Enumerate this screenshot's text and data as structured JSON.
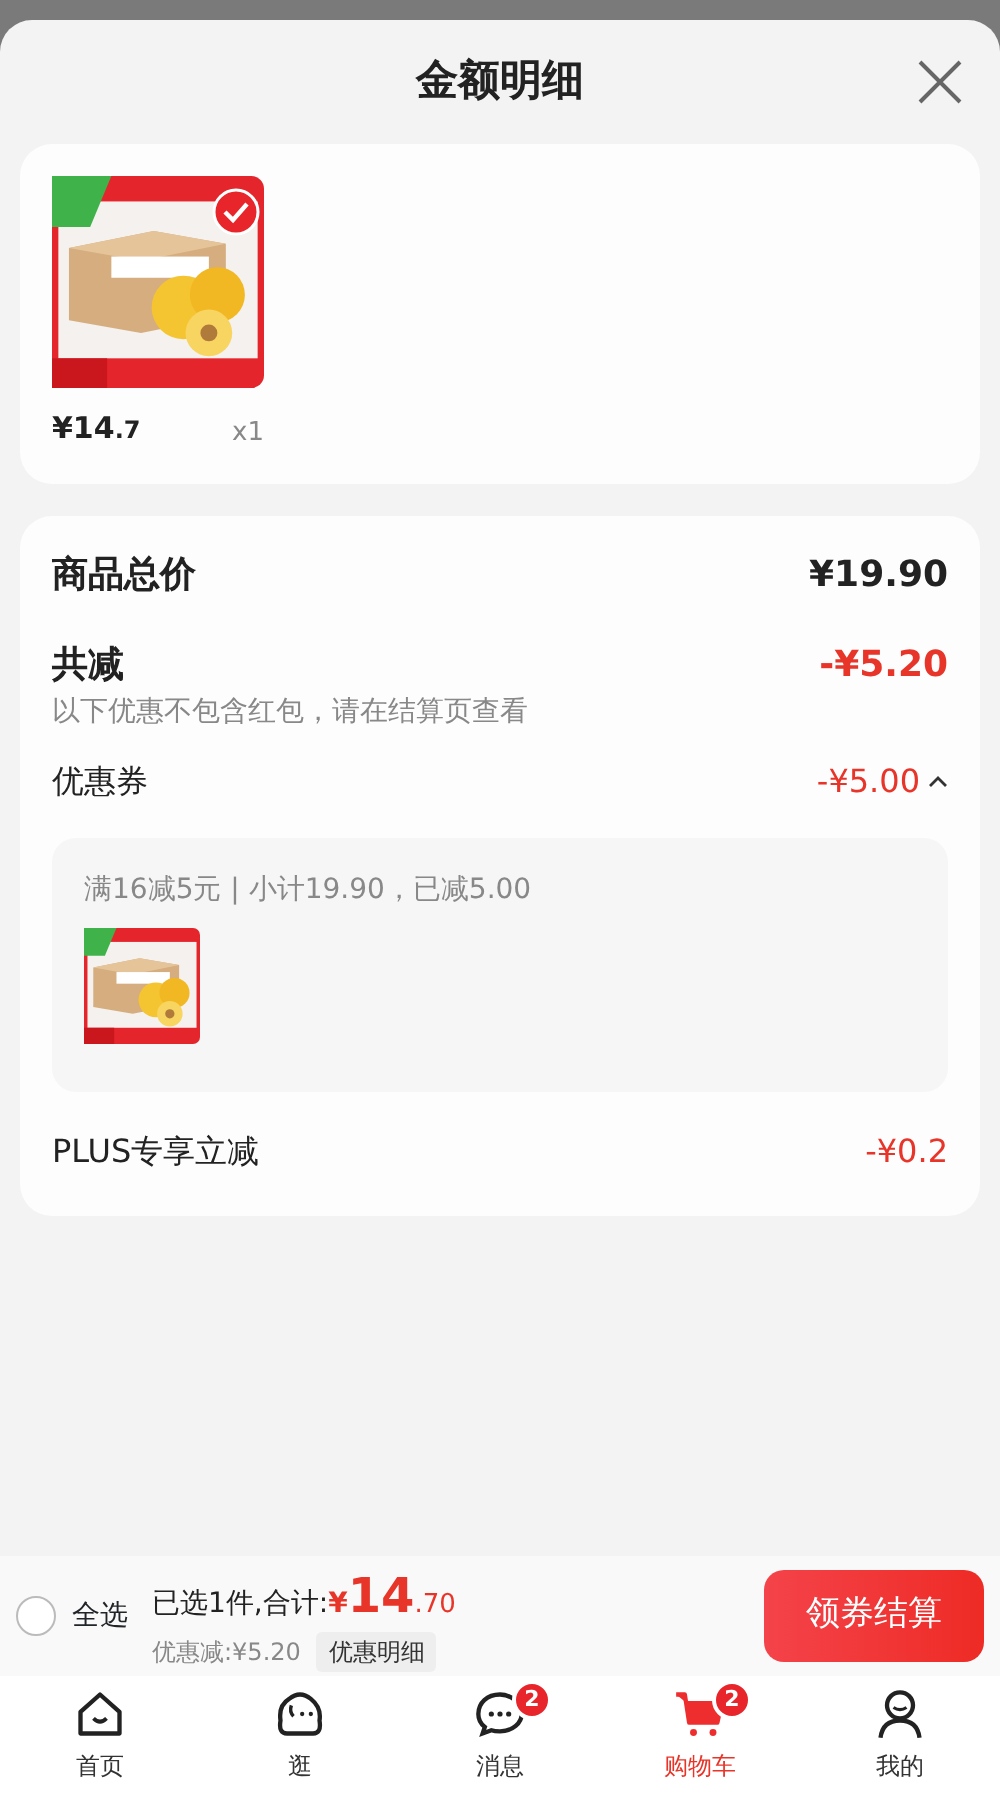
{
  "sheet": {
    "title": "金额明细"
  },
  "products": [
    {
      "price_main": "¥14",
      "price_decimal": ".7",
      "quantity": "x1",
      "selected": true
    }
  ],
  "summary": {
    "total_label": "商品总价",
    "total_value": "¥19.90",
    "discount_label": "共减",
    "discount_value": "-¥5.20",
    "note": "以下优惠不包含红包，请在结算页查看"
  },
  "coupon": {
    "label": "优惠券",
    "value": "-¥5.00",
    "expanded": true,
    "detail": "满16减5元 | 小计19.90，已减5.00"
  },
  "plus": {
    "label": "PLUS专享立减",
    "value": "-¥0.2"
  },
  "checkout_bar": {
    "select_all_label": "全选",
    "select_all_checked": false,
    "selected_text": "已选1件,合计:",
    "currency": "¥",
    "total_main": "14",
    "total_decimal": ".70",
    "discount_text": "优惠减:¥5.20",
    "details_button": "优惠明细",
    "checkout_button": "领券结算"
  },
  "tab_bar": [
    {
      "label": "首页",
      "selected": false
    },
    {
      "label": "逛",
      "selected": false
    },
    {
      "label": "消息",
      "selected": false,
      "badge": "2"
    },
    {
      "label": "购物车",
      "selected": true,
      "badge": "2"
    },
    {
      "label": "我的",
      "selected": false
    }
  ]
}
